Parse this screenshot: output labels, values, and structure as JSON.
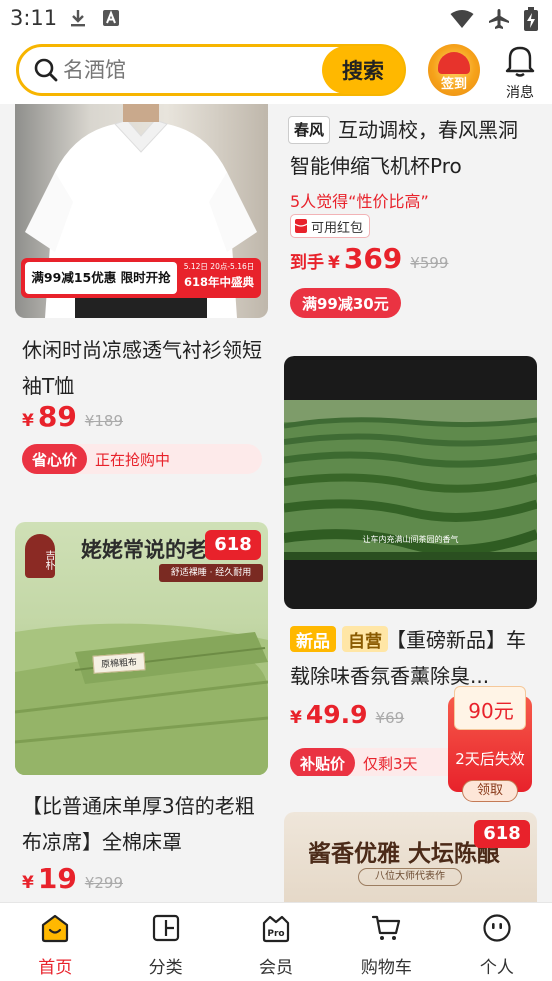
{
  "status_bar": {
    "time": "3:11"
  },
  "header": {
    "search_placeholder": "名酒馆",
    "search_button": "搜索",
    "checkin_label": "签到",
    "messages_label": "消息"
  },
  "products": [
    {
      "image_banner": "满99减15优惠 限时开抢",
      "image_dates": "5.12日 20点-5.16日",
      "image_sale": "618年中盛典",
      "title": "休闲时尚凉感透气衬衫领短袖T恤",
      "currency": "¥",
      "price": "89",
      "original_price": "¥189",
      "promo_tag": "省心价",
      "promo_text": "正在抢购中"
    },
    {
      "brand_logo": "春风",
      "title": "互动调校，春风黑洞智能伸缩飞机杯Pro",
      "reviews": "5人觉得“性价比高”",
      "coupon_tag": "可用红包",
      "price_prefix": "到手",
      "currency": "¥",
      "price": "369",
      "original_price": "¥599",
      "promo_tag": "满99减30元"
    },
    {
      "video_caption": "让车内充满山间茶园的香气",
      "badge_new": "新品",
      "badge_self": "自营",
      "title": "【重磅新品】车载除味香氛香薰除臭...",
      "currency": "¥",
      "price": "49.9",
      "original_price": "¥69",
      "promo_tag": "补贴价",
      "promo_text": "仅剩3天"
    },
    {
      "image_headline": "姥姥常说的老",
      "image_sub": "舒适裸睡 · 经久耐用",
      "image_logo": "吉朴",
      "image_label": "原棉粗布",
      "sale_badge": "618",
      "title": "【比普通床单厚3倍的老粗布凉席】全棉床罩",
      "currency": "¥",
      "price": "19",
      "original_price": "¥299"
    },
    {
      "image_headline": "酱香优雅 大坛陈酿",
      "image_sub": "八位大师代表作",
      "sale_badge": "618"
    }
  ],
  "floating_coupon": {
    "amount": "90元",
    "expiry": "2天后失效",
    "claim": "领取"
  },
  "bottom_nav": [
    {
      "label": "首页",
      "icon": "home-icon",
      "active": true
    },
    {
      "label": "分类",
      "icon": "category-icon"
    },
    {
      "label": "会员",
      "icon": "pro-member-icon"
    },
    {
      "label": "购物车",
      "icon": "cart-icon"
    },
    {
      "label": "个人",
      "icon": "profile-icon"
    }
  ],
  "colors": {
    "accent_yellow": "#ffb800",
    "price_red": "#e8222b",
    "tag_red": "#ea3342"
  }
}
